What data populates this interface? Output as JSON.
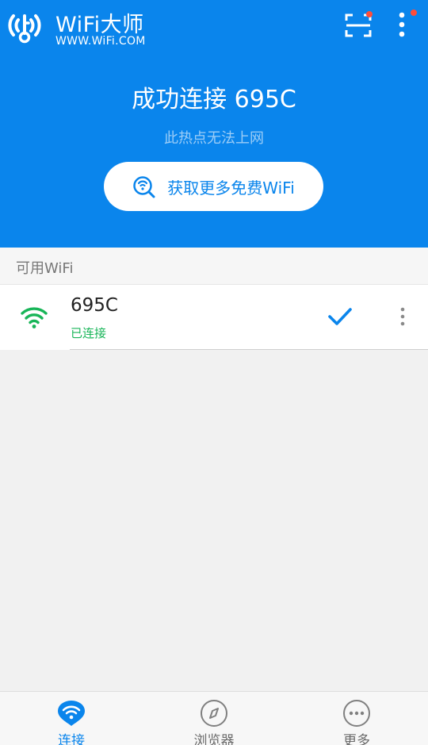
{
  "app": {
    "title": "WiFi大师",
    "url": "WWW.WiFi.COM"
  },
  "colors": {
    "primary": "#0a85ec",
    "connected_green": "#18b558",
    "badge_red": "#ff4d3a"
  },
  "status": {
    "title": "成功连接 695C",
    "subtitle": "此热点无法上网",
    "action_label": "获取更多免费WiFi"
  },
  "list": {
    "section_label": "可用WiFi",
    "items": [
      {
        "name": "695C",
        "state": "已连接",
        "icon": "wifi-signal-icon",
        "connected": true
      }
    ]
  },
  "nav": {
    "items": [
      {
        "label": "连接",
        "icon": "wifi-icon",
        "active": true
      },
      {
        "label": "浏览器",
        "icon": "compass-icon",
        "active": false
      },
      {
        "label": "更多",
        "icon": "more-dots-icon",
        "active": false
      }
    ]
  }
}
